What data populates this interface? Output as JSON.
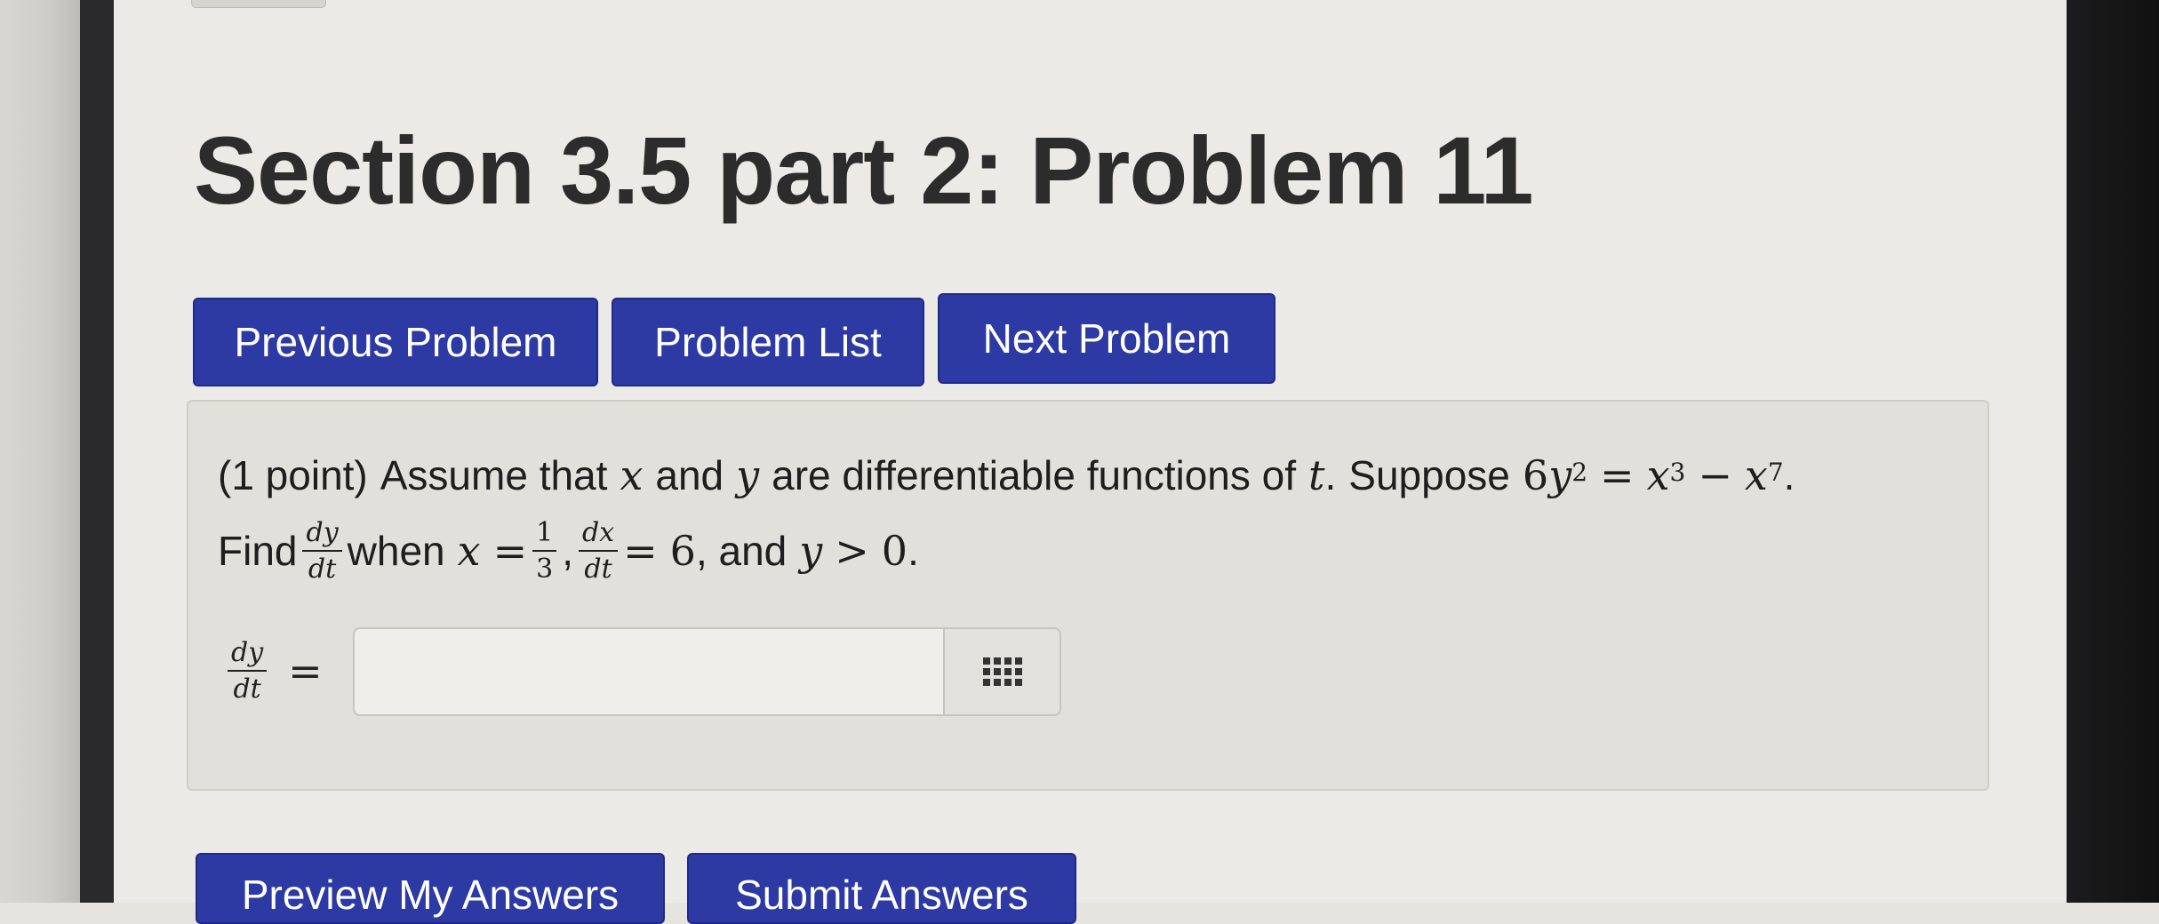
{
  "page": {
    "title": "Section 3.5 part 2: Problem 11"
  },
  "nav": {
    "previous_label": "Previous Problem",
    "list_label": "Problem List",
    "next_label": "Next Problem"
  },
  "problem": {
    "points": "(1 point)",
    "intro": "Assume that",
    "var_x": "x",
    "and_word": "and",
    "var_y": "y",
    "functions_text": "are differentiable functions of",
    "var_t": "t",
    "period": ".",
    "suppose_word": "Suppose",
    "eq_coeff": "6",
    "eq_y": "y",
    "eq_exp_y": "2",
    "eq_equals": "=",
    "eq_x1": "x",
    "eq_exp_x1": "3",
    "eq_minus": "−",
    "eq_x2": "x",
    "eq_exp_x2": "7",
    "find_word": "Find",
    "dydt_num": "dy",
    "dydt_den": "dt",
    "when_word": "when",
    "when_x": "x",
    "when_equals": "=",
    "x_num": "1",
    "x_den": "3",
    "comma": ",",
    "dxdt_num": "dx",
    "dxdt_den": "dt",
    "dxdt_equals": "=",
    "dxdt_value": "6",
    "and_word2": ", and",
    "cond_y": "y",
    "cond_gt": ">",
    "cond_value": "0",
    "final_period": "."
  },
  "answer": {
    "label_num": "dy",
    "label_den": "dt",
    "equals": "=",
    "value": "",
    "placeholder": "",
    "keypad_icon": "grid-keypad-icon"
  },
  "actions": {
    "preview_label": "Preview My Answers",
    "submit_label": "Submit Answers"
  },
  "colors": {
    "button_bg": "#2d3aa3",
    "background": "#eceae6",
    "problem_box": "#e2e0db"
  }
}
